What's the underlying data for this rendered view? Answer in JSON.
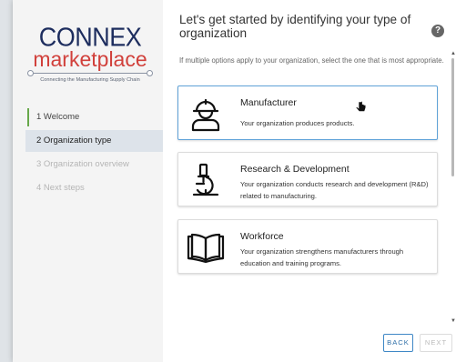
{
  "logo": {
    "brand": "CONNEX",
    "product": "marketplace",
    "tagline": "Connecting the Manufacturing Supply Chain"
  },
  "steps": [
    {
      "label": "1  Welcome",
      "state": "done"
    },
    {
      "label": "2  Organization type",
      "state": "active"
    },
    {
      "label": "3  Organization overview",
      "state": "disabled"
    },
    {
      "label": "4  Next steps",
      "state": "disabled"
    }
  ],
  "header": {
    "title": "Let's get started by identifying your type of organization",
    "help_icon": "?",
    "subtitle": "If multiple options apply to your organization, select the one that is most appropriate."
  },
  "options": [
    {
      "icon": "worker-hardhat-icon",
      "title": "Manufacturer",
      "description": "Your organization produces products.",
      "selected": true
    },
    {
      "icon": "microscope-icon",
      "title": "Research & Development",
      "description": "Your organization conducts research and development (R&D) related to manufacturing.",
      "selected": false
    },
    {
      "icon": "open-book-icon",
      "title": "Workforce",
      "description": "Your organization strengthens manufacturers through education and training programs.",
      "selected": false
    }
  ],
  "buttons": {
    "back": "BACK",
    "next": "NEXT"
  },
  "colors": {
    "brand_navy": "#1d2d5e",
    "brand_red": "#d1403b",
    "accent_blue": "#3e87c6",
    "done_green": "#67a84a"
  }
}
